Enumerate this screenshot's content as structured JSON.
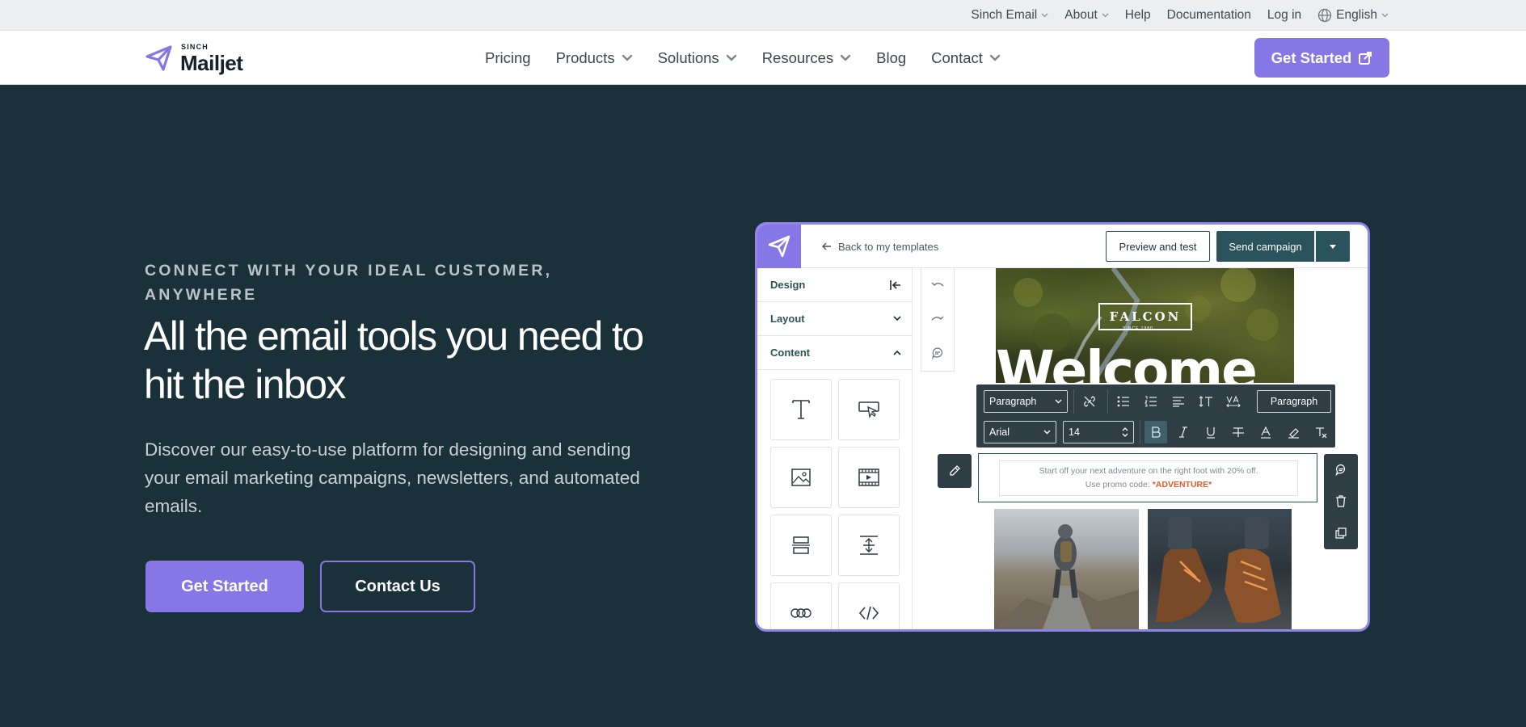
{
  "utility": {
    "items": [
      {
        "label": "Sinch Email",
        "dropdown": true
      },
      {
        "label": "About",
        "dropdown": true
      },
      {
        "label": "Help",
        "dropdown": false
      },
      {
        "label": "Documentation",
        "dropdown": false
      },
      {
        "label": "Log in",
        "dropdown": false
      },
      {
        "label": "English",
        "dropdown": true,
        "icon": "globe-icon"
      }
    ]
  },
  "nav": {
    "logo_small": "SINCH",
    "logo_big": "Mailjet",
    "links": [
      {
        "label": "Pricing",
        "dropdown": false
      },
      {
        "label": "Products",
        "dropdown": true
      },
      {
        "label": "Solutions",
        "dropdown": true
      },
      {
        "label": "Resources",
        "dropdown": true
      },
      {
        "label": "Blog",
        "dropdown": false
      },
      {
        "label": "Contact",
        "dropdown": true
      }
    ],
    "cta_label": "Get Started"
  },
  "hero": {
    "eyebrow": "CONNECT WITH YOUR IDEAL CUSTOMER, ANYWHERE",
    "headline": "All the email tools you need to hit the inbox",
    "subtext": "Discover our easy-to-use platform for designing and sending your email marketing campaigns, newsletters, and automated emails.",
    "primary_button": "Get Started",
    "secondary_button": "Contact Us"
  },
  "editor": {
    "back_label": "Back to my templates",
    "preview_label": "Preview and test",
    "send_label": "Send campaign",
    "side_sections": [
      {
        "label": "Design",
        "icon": "collapse-left-icon"
      },
      {
        "label": "Layout",
        "icon": "chevron-down-icon"
      },
      {
        "label": "Content",
        "icon": "chevron-up-icon"
      }
    ],
    "content_tiles": [
      "text-block-icon",
      "button-block-icon",
      "image-block-icon",
      "video-block-icon",
      "section-block-icon",
      "spacer-block-icon",
      "social-block-icon",
      "html-block-icon"
    ],
    "falcon_label": "FALCON",
    "falcon_since": "SINCE 1980",
    "welcome_text": "Welcome",
    "toolbar": {
      "block_type": "Paragraph",
      "style_button": "Paragraph",
      "font": "Arial",
      "size": "14"
    },
    "body_line1": "Start off your next adventure on the right foot with 20% off.",
    "body_line2_prefix": "Use promo code:",
    "promo_code": "*ADVENTURE*"
  },
  "colors": {
    "page_bg": "#1b313a",
    "accent": "#8676e6",
    "editor_teal": "#2b535d",
    "promo": "#e35d2f"
  }
}
